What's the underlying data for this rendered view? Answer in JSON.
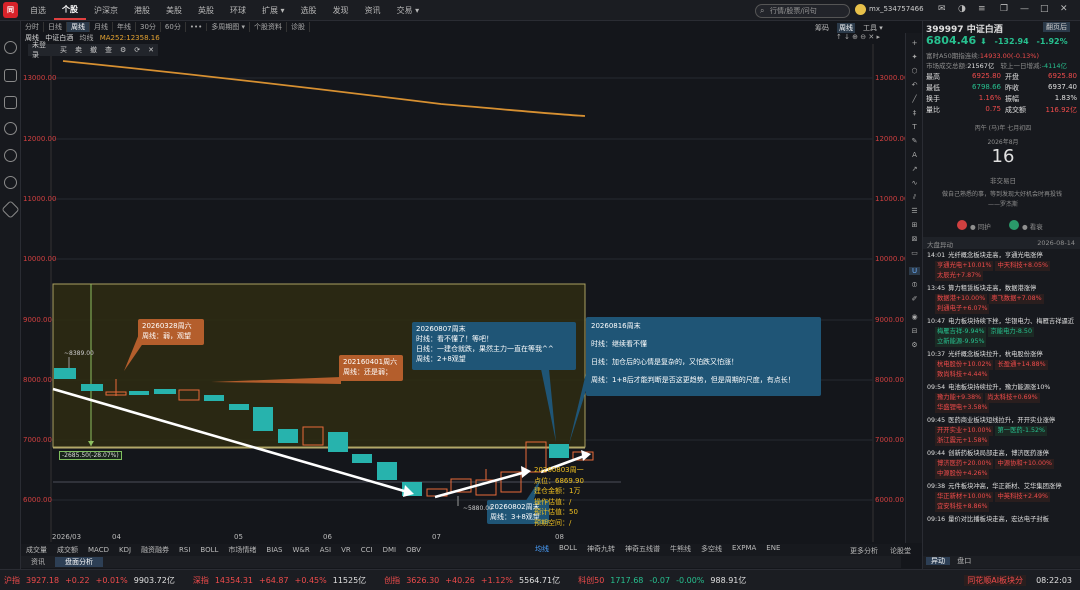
{
  "topnav": [
    "自选",
    "个股",
    "沪深京",
    "港股",
    "美股",
    "英股",
    "环球",
    "扩展 ▾",
    "选股",
    "发现",
    "资讯",
    "交易 ▾"
  ],
  "search_placeholder": "行情/股票/问句",
  "user": "mx_534757466",
  "tabs2": [
    "分时",
    "日线",
    "周线",
    "月线",
    "年线",
    "30分",
    "60分",
    "•••",
    "多周期图 ▾",
    "个股资料",
    "诊股"
  ],
  "tabs2_active": "周线",
  "chart_header": {
    "period": "周线",
    "name": "中证白酒",
    "avg": "均线",
    "ma": "MA252:12358.16"
  },
  "drawbar": [
    "未登录",
    "买",
    "卖",
    "撤",
    "查",
    "⚙",
    "⟳",
    "✕"
  ],
  "right_tabs": {
    "t1": "筹码",
    "t2": "周线",
    "t3": "工具 ▾",
    "t4": "翻页后"
  },
  "stock": {
    "code": "399997",
    "name": "中证白酒",
    "price": "6804.46",
    "arrow": "⬇",
    "chg": "-132.94",
    "pct": "-1.92%"
  },
  "details": [
    {
      "l": "富时A50期指连续:",
      "v": "14933.00(-0.13%)"
    },
    {
      "l": "市场成交总额:",
      "v": "21567亿",
      "l2": "较上一日增减:",
      "v2": "-4114亿"
    }
  ],
  "quote": [
    [
      "最高",
      "6925.80",
      "开盘",
      "6925.80"
    ],
    [
      "最低",
      "6798.66",
      "昨收",
      "6937.40"
    ],
    [
      "换手",
      "1.16%",
      "振幅",
      "1.83%"
    ],
    [
      "量比",
      "0.75",
      "成交额",
      "116.92亿"
    ]
  ],
  "calendar": {
    "small": "丙午 (马)年 七月初四",
    "date": "2026年8月",
    "day": "16",
    "note": "非交易日",
    "quote": "做自己熟悉的事，等到发现大好机会时再投钱",
    "author": "——罗杰斯",
    "up": "同护",
    "down": "看衰"
  },
  "news_header": {
    "title": "大盘异动",
    "date": "2026-08-14"
  },
  "news": [
    {
      "t": "14:01",
      "h": "光纤概念板块走高，亨通光电涨停",
      "s": [
        [
          "亨通光电",
          "+10.01%"
        ],
        [
          "中天科技",
          "+8.05%"
        ],
        [
          "太辰光",
          "+7.87%"
        ]
      ]
    },
    {
      "t": "13:45",
      "h": "算力租赁板块走高，数据港涨停",
      "s": [
        [
          "数据港",
          "+10.00%"
        ],
        [
          "奥飞数据",
          "+7.08%"
        ],
        [
          "利通电子",
          "+6.07%"
        ]
      ]
    },
    {
      "t": "10:47",
      "h": "电力板块持续下挫，华银电力、梅雁吉祥逼近",
      "s": [
        [
          "梅雁吉祥",
          "-9.94%"
        ],
        [
          "京能电力",
          "-8.50"
        ],
        [
          "立新能源",
          "-9.95%"
        ]
      ]
    },
    {
      "t": "10:37",
      "h": "光纤概念板块拉升，杭电股份涨停",
      "s": [
        [
          "杭电股份",
          "+10.02%"
        ],
        [
          "长盈通",
          "+14.88%"
        ],
        [
          "致尚科技",
          "+4.44%"
        ]
      ]
    },
    {
      "t": "09:54",
      "h": "电池板块持续拉升，豫力能源涨10%",
      "s": [
        [
          "豫力能",
          "+9.38%"
        ],
        [
          "尚太科技",
          "+0.69%"
        ],
        [
          "华盛锂电",
          "+3.58%"
        ]
      ]
    },
    {
      "t": "09:45",
      "h": "医药商业板块短线拉升，开开实业涨停",
      "s": [
        [
          "开开实业",
          "+10.00%"
        ],
        [
          "第一医药",
          "-1.52%"
        ],
        [
          "浙江震元",
          "+1.58%"
        ]
      ]
    },
    {
      "t": "09:44",
      "h": "创新药板块局部走高，博济医药涨停",
      "s": [
        [
          "博济医药",
          "+20.00%"
        ],
        [
          "中源协和",
          "+10.00%"
        ],
        [
          "中源股份",
          "+4.26%"
        ]
      ]
    },
    {
      "t": "09:38",
      "h": "元件板块冲高，华正新材、艾华集团涨停",
      "s": [
        [
          "华正新材",
          "+10.00%"
        ],
        [
          "中英科技",
          "+2.49%"
        ],
        [
          "宜安科技",
          "+8.86%"
        ]
      ]
    },
    {
      "t": "09:16",
      "h": "量价对比播板块走高，宏达电子封板",
      "s": []
    }
  ],
  "right_bottom": {
    "a": "更多分析",
    "b": "论股堂",
    "c": "异动",
    "d": "盘口"
  },
  "indicators": [
    "成交量",
    "成交额",
    "MACD",
    "KDJ",
    "融资融券",
    "RSI",
    "BOLL",
    "市场情绪",
    "BIAS",
    "W&R",
    "ASI",
    "VR",
    "CCI",
    "DMI",
    "OBV"
  ],
  "indicators2": [
    "均线",
    "BOLL",
    "神奇九转",
    "神奇五线谱",
    "牛熊线",
    "多空线",
    "EXPMA",
    "ENE"
  ],
  "bottom_tabs": [
    "资讯",
    "盘面分析"
  ],
  "y_ticks": [
    "13000.00",
    "12000.00",
    "11000.00",
    "10000.00",
    "9000.00",
    "8000.00",
    "7000.00",
    "6000.00"
  ],
  "x_ticks": [
    "2026/03",
    "04",
    "05",
    "06",
    "07",
    "08"
  ],
  "annotations": {
    "a1": [
      "20260328周六",
      "周线：弱，观望"
    ],
    "a2": [
      "202160401周六",
      "周线：还是弱；"
    ],
    "a3": [
      "20260807周末",
      "时线：看不懂了！等吧！",
      "日线：一建仓就跌，果然主力一直在等我^^",
      "周线：2+8观望"
    ],
    "a4": [
      "20260816周末",
      "时线：继续看不懂",
      "日线：加仓后的心情是复杂的，又怕跌又怕涨！",
      "周线：1+8后才能判断是否这更趋势，但是周期的尺度，有点长！"
    ],
    "a5": [
      "20260802周末",
      "周线：3+8观望"
    ],
    "a6": [
      "20260803周一",
      "点位：6869.90",
      "建仓金额：1万",
      "操作估值：/",
      "预计估值：50",
      "预期空间：/"
    ],
    "l1": "~8389.00",
    "l2": "-2685.50(-28.07%)",
    "l3": "~5880.00"
  },
  "status": [
    {
      "n": "沪指",
      "p": "3927.18",
      "c": "+0.22",
      "pc": "+0.01%",
      "v": "9903.72亿"
    },
    {
      "n": "深指",
      "p": "14354.31",
      "c": "+64.87",
      "pc": "+0.45%",
      "v": "11525亿"
    },
    {
      "n": "创指",
      "p": "3626.30",
      "c": "+40.26",
      "pc": "+1.12%",
      "v": "5564.71亿"
    },
    {
      "n": "科创50",
      "p": "1717.68",
      "c": "-0.07",
      "pc": "-0.00%",
      "v": "988.91亿"
    }
  ],
  "status_right": {
    "a": "同花顺AI板块分",
    "time": "08:22:03"
  }
}
